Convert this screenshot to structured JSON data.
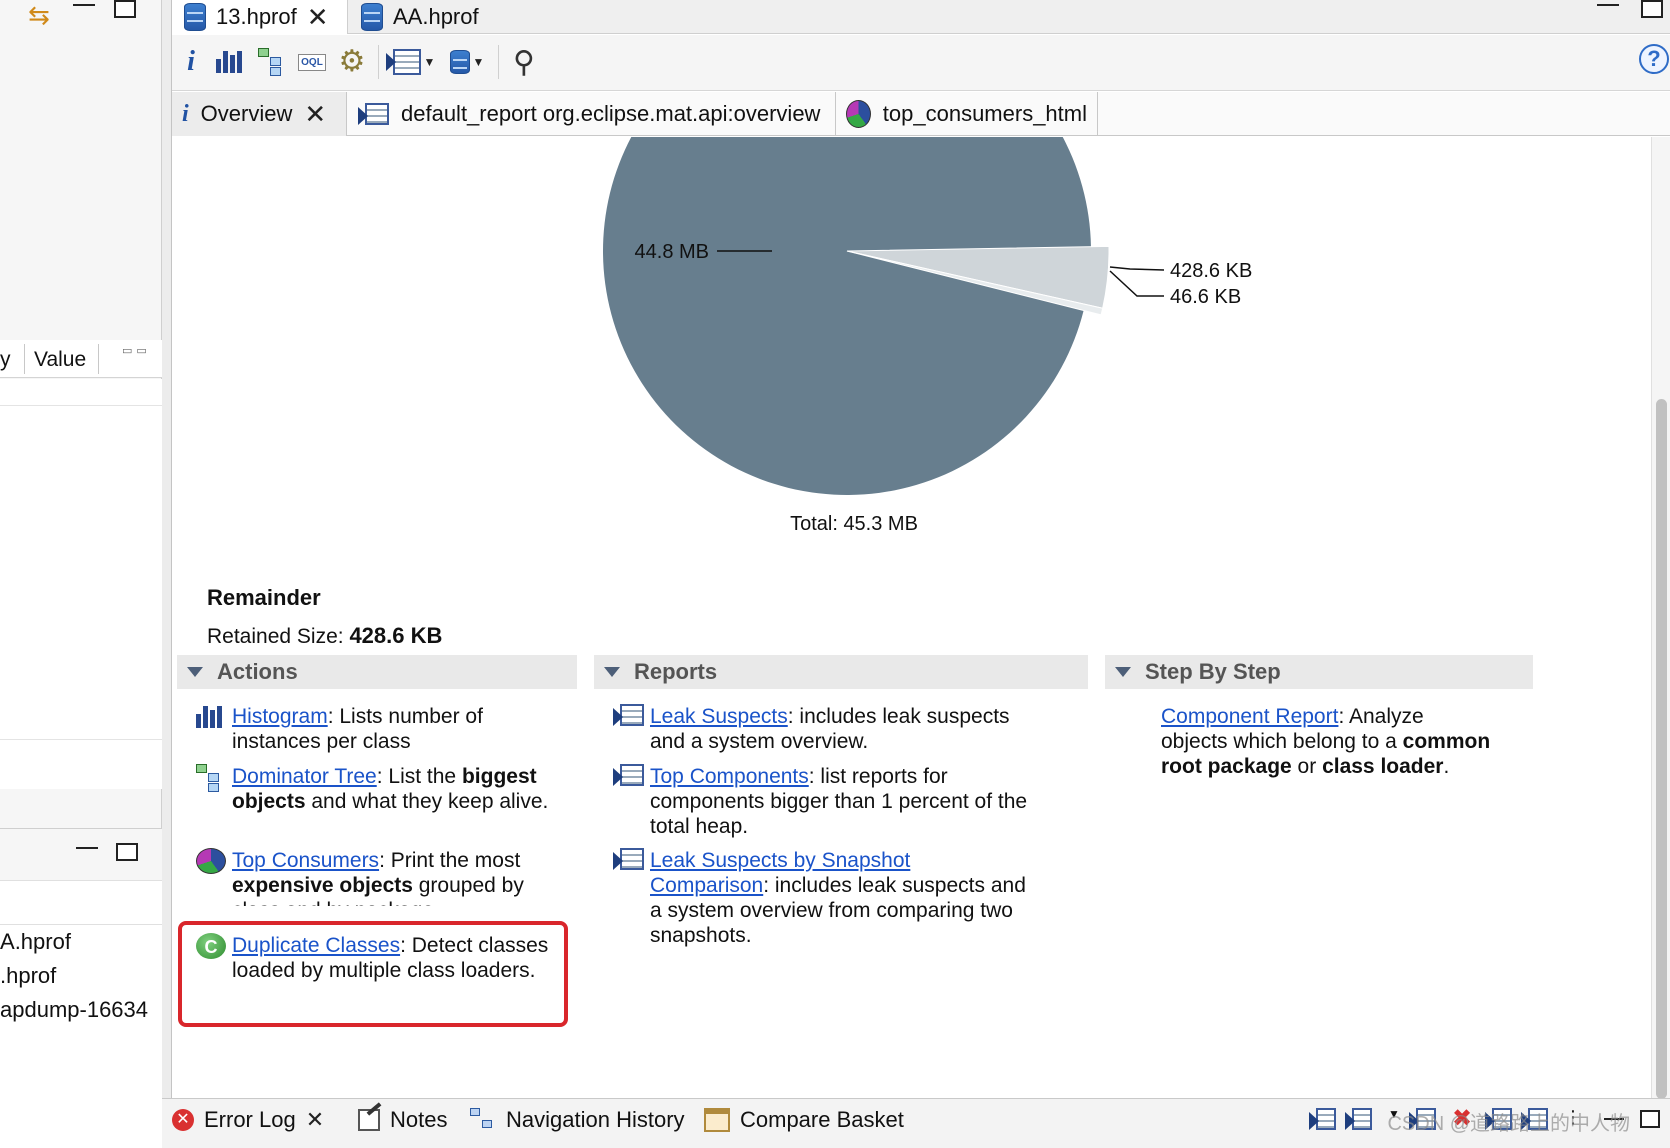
{
  "file_tabs": [
    {
      "label": "13.hprof",
      "active": true
    },
    {
      "label": "AA.hprof",
      "active": false
    }
  ],
  "toolbar": {
    "items": [
      "info-icon",
      "histogram-icon",
      "dominator-tree-icon",
      "oql-icon",
      "heap-dump-overview-icon",
      "run-report-icon",
      "query-browser-icon",
      "search-icon"
    ],
    "oql_text": "OQL",
    "help_text": "?"
  },
  "sub_tabs": [
    {
      "label": "Overview",
      "icon": "info-icon",
      "closable": true
    },
    {
      "label": "default_report  org.eclipse.mat.api:overview",
      "icon": "report-icon",
      "closable": false
    },
    {
      "label": "top_consumers_html",
      "icon": "pie-icon",
      "closable": false
    }
  ],
  "left_panel": {
    "properties_header": {
      "key_fragment": "y",
      "value": "Value"
    },
    "heap_dumps": [
      ".hprof",
      ".hprof",
      "apdump-16634"
    ],
    "heap_dump_prefixes": [
      "A",
      "",
      ""
    ]
  },
  "chart_data": {
    "type": "pie",
    "slices": [
      {
        "label": "44.8 MB",
        "value": 44.8,
        "unit": "MB",
        "color": "#677e8e"
      },
      {
        "label": "428.6 KB",
        "value": 0.4286,
        "unit": "MB",
        "color": "#cfd5d9"
      },
      {
        "label": "46.6 KB",
        "value": 0.0466,
        "unit": "MB",
        "color": "#e8ecee"
      }
    ],
    "total_label": "Total: 45.3 MB"
  },
  "remainder": {
    "title": "Remainder",
    "retained_label": "Retained Size:",
    "retained_value": "428.6 KB"
  },
  "sections": {
    "actions": {
      "title": "Actions",
      "items": [
        {
          "link": "Histogram",
          "pre": ": Lists number of instances per class"
        },
        {
          "link": "Dominator Tree",
          "pre": ": List the ",
          "bold": "biggest objects",
          "post": " and what they keep alive."
        },
        {
          "link": "Top Consumers",
          "pre": ": Print the most ",
          "bold": "expensive objects",
          "post": " grouped by class and by package."
        },
        {
          "link": "Duplicate Classes",
          "pre": ": Detect classes loaded by multiple class loaders."
        }
      ]
    },
    "reports": {
      "title": "Reports",
      "items": [
        {
          "link": "Leak Suspects",
          "pre": ": includes leak suspects and a system overview."
        },
        {
          "link": "Top Components",
          "pre": ": list reports for components bigger than 1 percent of the total heap."
        },
        {
          "link": "Leak Suspects by Snapshot Comparison",
          "pre": ": includes leak suspects and a system overview from comparing two snapshots."
        }
      ]
    },
    "step_by_step": {
      "title": "Step By Step",
      "items": [
        {
          "link": "Component Report",
          "pre": ": Analyze objects which belong to a ",
          "bold": "common root package",
          "mid": " or ",
          "bold2": "class loader",
          "post": "."
        }
      ]
    }
  },
  "bottom_tabs": [
    {
      "label": "Error Log",
      "closable": true
    },
    {
      "label": "Notes"
    },
    {
      "label": "Navigation History"
    },
    {
      "label": "Compare Basket"
    }
  ],
  "watermark": "CSDN @道路路上的中人物",
  "colors": {
    "link": "#1a53c9",
    "highlight": "#d9262b",
    "pie_main": "#677e8e"
  }
}
